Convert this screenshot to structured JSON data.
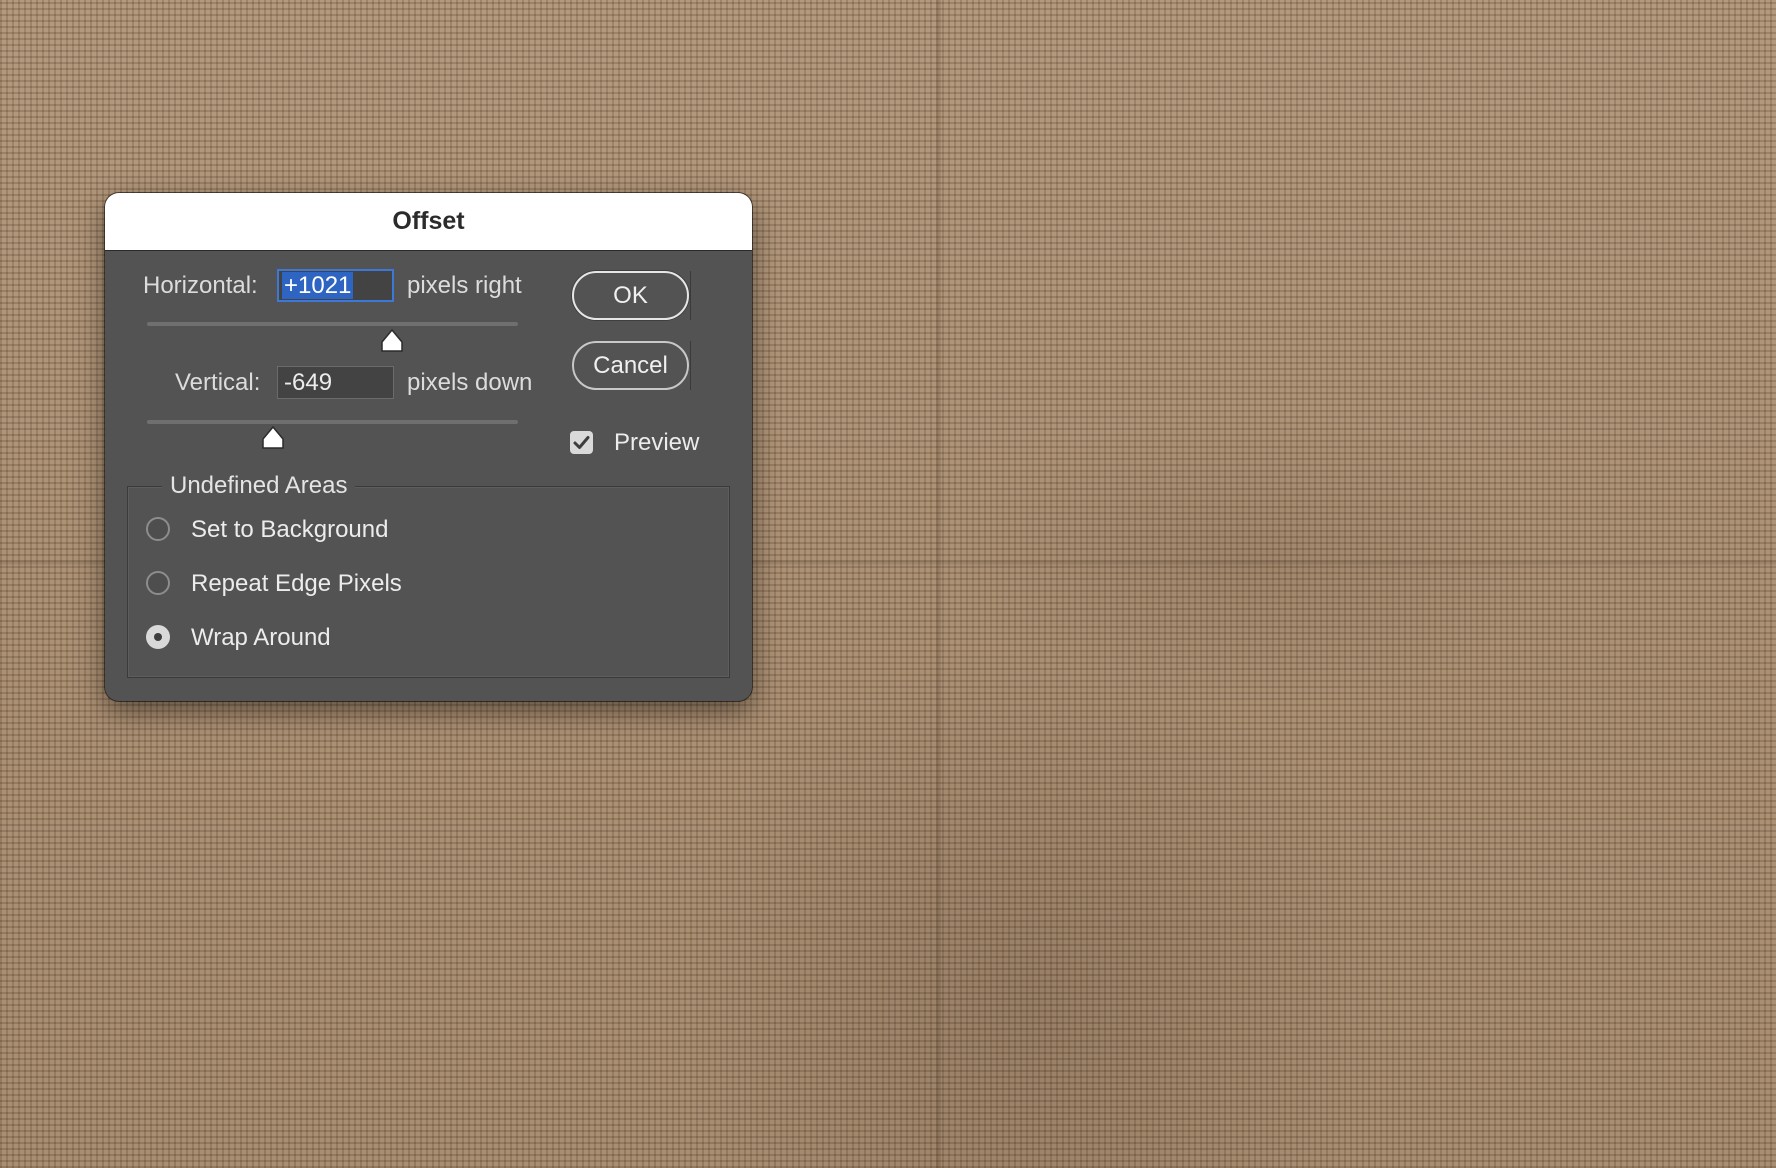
{
  "dialog": {
    "title": "Offset",
    "horizontal": {
      "label": "Horizontal:",
      "value": "+1021",
      "unit": "pixels right",
      "slider_position": 0.66
    },
    "vertical": {
      "label": "Vertical:",
      "value": "-649",
      "unit": "pixels down",
      "slider_position": 0.34
    },
    "buttons": {
      "ok": "OK",
      "cancel": "Cancel"
    },
    "preview": {
      "label": "Preview",
      "checked": true
    },
    "undefined_areas": {
      "legend": "Undefined Areas",
      "options": [
        {
          "label": "Set to Background",
          "selected": false
        },
        {
          "label": "Repeat Edge Pixels",
          "selected": false
        },
        {
          "label": "Wrap Around",
          "selected": true
        }
      ]
    }
  },
  "colors": {
    "dialog_background": "#535353",
    "titlebar_background": "#ffffff",
    "selection_highlight": "#2e64c2",
    "focus_ring": "#3c78d8",
    "burlap_background": "#a08468"
  }
}
